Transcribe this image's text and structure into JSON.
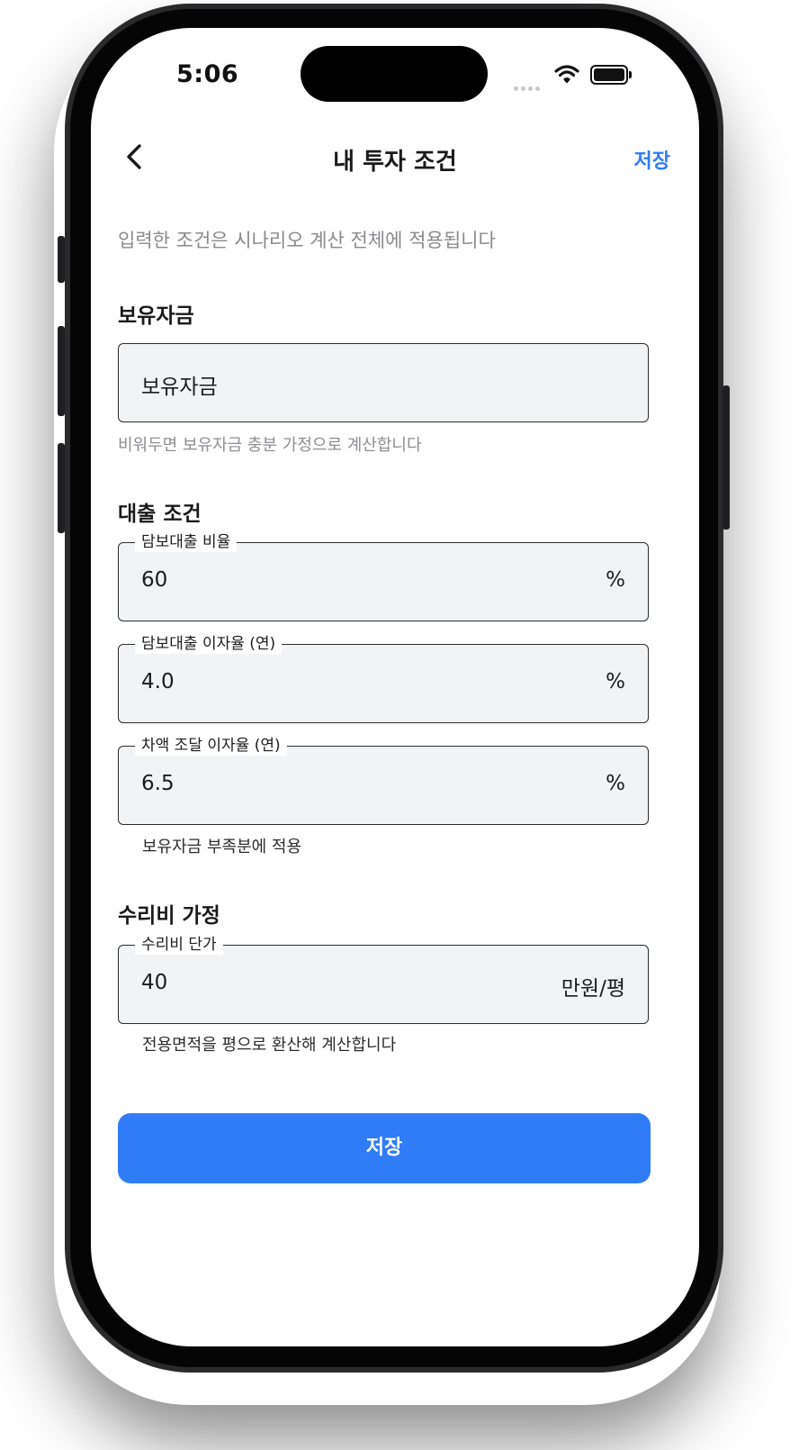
{
  "status_bar": {
    "time": "5:06"
  },
  "nav": {
    "title": "내 투자 조건",
    "save_label": "저장"
  },
  "description": "입력한 조건은 시나리오 계산 전체에 적용됩니다",
  "funds": {
    "section_title": "보유자금",
    "placeholder": "보유자금",
    "hint": "비워두면 보유자금 충분 가정으로 계산합니다"
  },
  "loan": {
    "section_title": "대출 조건",
    "ltv": {
      "label": "담보대출 비율",
      "value": "60",
      "unit": "%"
    },
    "mortgage_rate": {
      "label": "담보대출 이자율 (연)",
      "value": "4.0",
      "unit": "%"
    },
    "gap_rate": {
      "label": "차액 조달 이자율 (연)",
      "value": "6.5",
      "unit": "%"
    },
    "gap_hint": "보유자금 부족분에 적용"
  },
  "repair": {
    "section_title": "수리비 가정",
    "unit_cost": {
      "label": "수리비 단가",
      "value": "40",
      "unit": "만원/평"
    },
    "hint": "전용면적을 평으로 환산해 계산합니다"
  },
  "primary_button": {
    "label": "저장"
  },
  "colors": {
    "accent": "#2f7cf6",
    "field_bg": "#f2f3f5"
  }
}
